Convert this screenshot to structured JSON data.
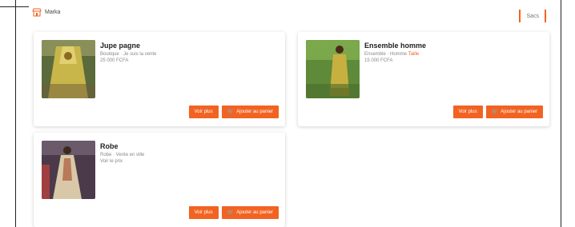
{
  "header": {
    "brand": "Marka",
    "cart_label": "Sacs"
  },
  "products": [
    {
      "title": "Jupe pagne",
      "detail": "Boutique · Je suis la vente",
      "price": "25 000 FCFA",
      "view_label": "Voir plus",
      "add_label": "Ajouter au panier"
    },
    {
      "title": "Ensemble homme",
      "detail": "Ensemble · Homme",
      "detail_accent": "Taille",
      "price": "15 000 FCFA",
      "view_label": "Voir plus",
      "add_label": "Ajouter au panier"
    },
    {
      "title": "Robe",
      "detail": "Robe · Vente en ville",
      "price": "Voir le prix",
      "view_label": "Voir plus",
      "add_label": "Ajouter au panier"
    }
  ],
  "colors": {
    "accent": "#f26322",
    "background": "#ffffff",
    "card": "#ffffff"
  }
}
